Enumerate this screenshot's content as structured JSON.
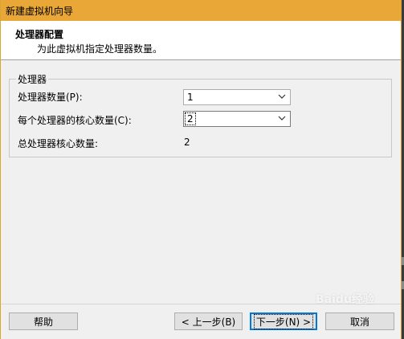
{
  "window": {
    "title": "新建虚拟机向导"
  },
  "header": {
    "title": "处理器配置",
    "subtitle": "为此虚拟机指定处理器数量。"
  },
  "group": {
    "label": "处理器",
    "processor_count": {
      "label": "处理器数量(P):",
      "value": "1"
    },
    "cores_per_processor": {
      "label": "每个处理器的核心数量(C):",
      "value": "2"
    },
    "total_cores": {
      "label": "总处理器核心数量:",
      "value": "2"
    }
  },
  "buttons": {
    "help": "帮助",
    "back": "< 上一步(B)",
    "next": "下一步(N) >",
    "cancel": "取消"
  },
  "watermark": "Baidu经验",
  "colors": {
    "titlebar": "#e8a736",
    "dialog_bg": "#f0f0f0",
    "default_button_border": "#0078d7"
  }
}
